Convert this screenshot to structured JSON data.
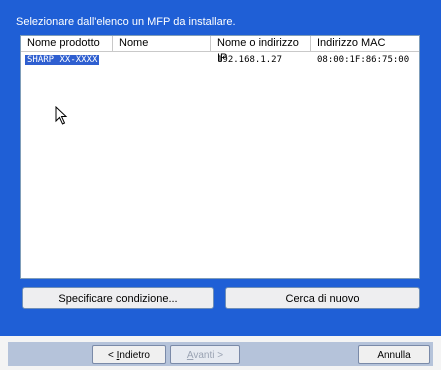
{
  "instruction": "Selezionare dall'elenco un MFP da installare.",
  "list": {
    "columns": [
      "Nome prodotto",
      "Nome",
      "Nome o indirizzo IP",
      "Indirizzo MAC"
    ],
    "rows": [
      {
        "product": "SHARP XX-XXXX",
        "name": "",
        "ip": "192.168.1.27",
        "mac": "08:00:1F:86:75:00",
        "selected": true
      }
    ]
  },
  "buttons": {
    "specify_condition": "Specificare condizione...",
    "search_again": "Cerca di nuovo"
  },
  "nav": {
    "back_prefix": "< ",
    "back_mnemonic": "I",
    "back_rest": "ndietro",
    "next_mnemonic": "A",
    "next_rest": "vanti",
    "next_suffix": " >",
    "cancel": "Annulla"
  },
  "colors": {
    "panel": "#1f5fd6",
    "selection": "#2f5fd0"
  },
  "icons": [
    "mouse-pointer-icon"
  ]
}
